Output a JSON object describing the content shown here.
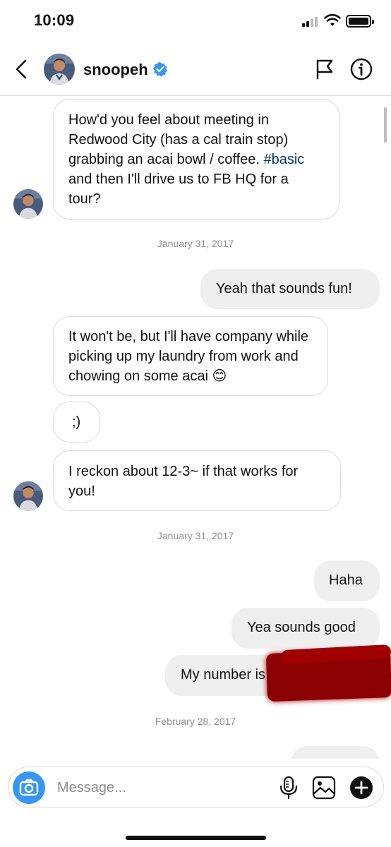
{
  "status_bar": {
    "time": "10:09",
    "battery_level": 1.0
  },
  "header": {
    "username": "snoopeh",
    "verified": true,
    "back_icon": "chevron-left-icon",
    "flag_icon": "flag-icon",
    "info_icon": "info-icon"
  },
  "messages": [
    {
      "from": "them",
      "text_before": "How'd you feel about meeting in Redwood City (has a cal train stop) grabbing an acai bowl / coffee. ",
      "hashtag": "#basic",
      "text_after": " and then I'll drive us to FB HQ for a tour?"
    },
    {
      "date": "January 31, 2017"
    },
    {
      "from": "me",
      "text": "Yeah that sounds fun!"
    },
    {
      "from": "them",
      "text": "It won't be, but I'll have company while picking up my laundry from work and chowing on some acai",
      "emoji": "😊"
    },
    {
      "from": "them",
      "text": ";)"
    },
    {
      "from": "them",
      "text": "I reckon about 12-3~ if that works for you!"
    },
    {
      "date": "January 31, 2017"
    },
    {
      "from": "me",
      "text": "Haha"
    },
    {
      "from": "me",
      "text": "Yea sounds good"
    },
    {
      "from": "me",
      "text": "My number is",
      "redacted": true
    },
    {
      "date": "February 28, 2017"
    }
  ],
  "composer": {
    "placeholder": "Message...",
    "camera_icon": "camera-icon",
    "mic_icon": "microphone-icon",
    "gallery_icon": "gallery-icon",
    "add_icon": "plus-icon"
  },
  "colors": {
    "accent": "#3797f0",
    "verified": "#3897f0",
    "hashtag": "#00376b",
    "outgoing_bubble": "#efefef",
    "border": "#dbdbdb",
    "meta_text": "#8e8e8e",
    "redaction": "#8b0000"
  }
}
